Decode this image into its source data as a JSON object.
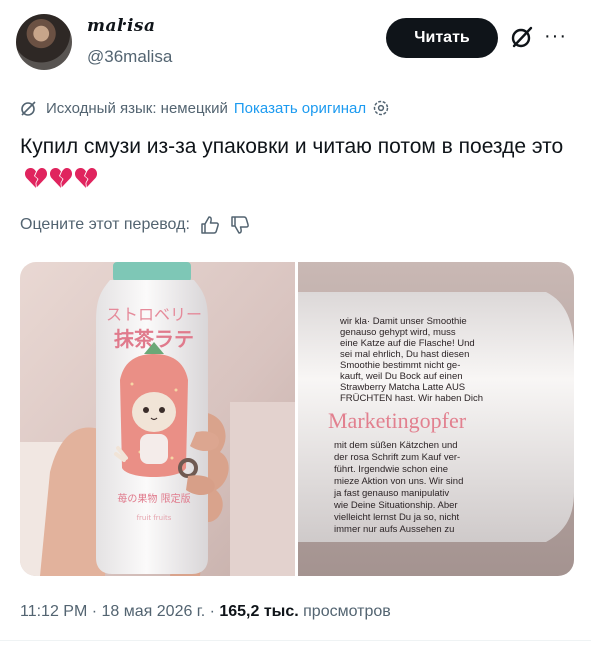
{
  "author": {
    "display_name": "maŀisa",
    "handle": "@36malisa",
    "follow_label": "Читать"
  },
  "translation": {
    "source_label": "Исходный язык: немецкий",
    "show_original": "Показать оригинал"
  },
  "tweet": {
    "text": "Купил смузи из-за упаковки и читаю потом в поезде это",
    "emoji_count": 3,
    "emoji_name": "broken-heart"
  },
  "rating": {
    "label": "Оцените этот перевод:"
  },
  "media": {
    "bottle_jp_line1": "ストロベリー",
    "bottle_jp_line2": "抹茶ラテ",
    "bottle_jp_small": "苺の果物 限定版",
    "bottle_small": "fruit fruits",
    "label_small_lines": [
      "wir kla· Damit unser Smoothie",
      "genauso gehypt wird, muss",
      "eine Katze auf die Flasche! Und",
      "sei mal ehrlich, Du hast diesen",
      "Smoothie bestimmt nicht ge-",
      "kauft, weil Du Bock auf einen",
      "Strawberry Matcha Latte AUS",
      "FRÜCHTEN hast. Wir haben Dich"
    ],
    "label_headline": "Marketingopfer",
    "label_lines": [
      "mit dem süßen Kätzchen und",
      "der rosa Schrift zum Kauf ver-",
      "führt. Irgendwie schon eine",
      "mieze Aktion von uns. Wir sind",
      "ja fast genauso manipulativ",
      "wie Deine Situationship. Aber",
      "vielleicht lernst Du ja so, nicht",
      "immer nur aufs Aussehen zu"
    ]
  },
  "meta": {
    "time": "11:12 PM · 18 мая 2026 г. · ",
    "views_count": "165,2 тыс.",
    "views_label": " просмотров"
  },
  "colors": {
    "accent": "#1d9bf0",
    "muted": "#536471",
    "text": "#0f1419",
    "heart": "#e0245e"
  }
}
